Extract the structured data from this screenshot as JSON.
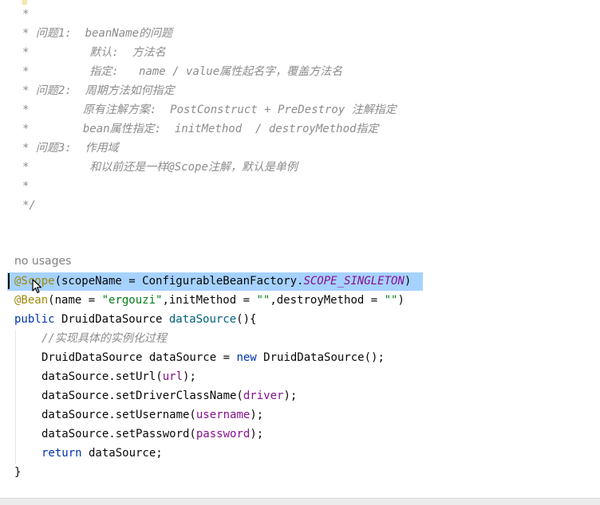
{
  "comment": {
    "l1": "*",
    "l2a": "* 问题1:  ",
    "l2b": "beanName的问题",
    "l3a": "*         ",
    "l3b": "默认:  方法名",
    "l4a": "*         ",
    "l4b": "指定:   name / value属性起名字，覆盖方法名",
    "l5a": "* 问题2:  ",
    "l5b": "周期方法如何指定",
    "l6a": "*        ",
    "l6b": "原有注解方案:  PostConstruct + PreDestroy 注解指定",
    "l7a": "*        ",
    "l7b": "bean属性指定:  initMethod  / destroyMethod指定",
    "l8a": "* 问题3:  ",
    "l8b": "作用域",
    "l9a": "*         ",
    "l9b": "和以前还是一样@Scope注解，默认是单例",
    "l10": "*",
    "l11": "*/"
  },
  "usage": "no usages",
  "code": {
    "scope_ann": "@Scope",
    "scope_open": "(scopeName = ConfigurableBeanFactory.",
    "scope_const": "SCOPE_SINGLETON",
    "scope_close": ")",
    "bean_ann": "@Bean",
    "bean_p1": "(name = ",
    "bean_s1": "\"ergouzi\"",
    "bean_p2": ",initMethod = ",
    "bean_s2": "\"\"",
    "bean_p3": ",destroyMethod = ",
    "bean_s3": "\"\"",
    "bean_p4": ")",
    "m_public": "public",
    "m_type": " DruidDataSource ",
    "m_name": "dataSource",
    "m_tail": "(){",
    "body_comment": "//实现具体的实例化过程",
    "b1a": "DruidDataSource dataSource = ",
    "b1kw": "new",
    "b1b": " DruidDataSource();",
    "b2a": "dataSource.setUrl(",
    "b2f": "url",
    "b2b": ");",
    "b3a": "dataSource.setDriverClassName(",
    "b3f": "driver",
    "b3b": ");",
    "b4a": "dataSource.setUsername(",
    "b4f": "username",
    "b4b": ");",
    "b5a": "dataSource.setPassword(",
    "b5f": "password",
    "b5b": ");",
    "ret_kw": "return",
    "ret_rest": " dataSource;",
    "close": "}"
  }
}
